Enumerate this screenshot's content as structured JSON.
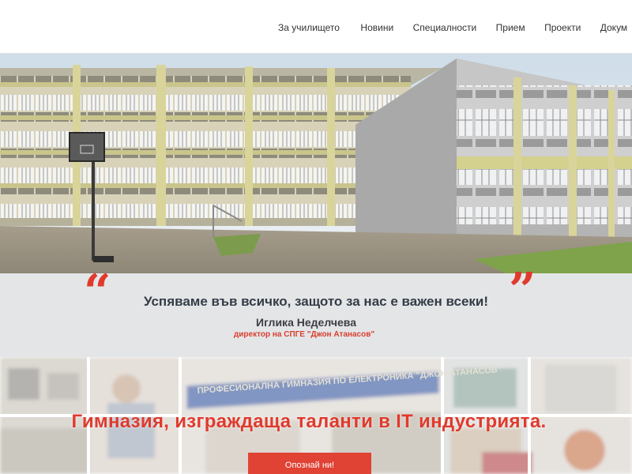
{
  "nav": {
    "items": [
      {
        "label": "За училището"
      },
      {
        "label": "Новини"
      },
      {
        "label": "Специалности"
      },
      {
        "label": "Прием"
      },
      {
        "label": "Проекти"
      },
      {
        "label": "Докум"
      }
    ]
  },
  "quote": {
    "text": "Успяваме във всичко, защото за нас е важен всеки!",
    "open_mark": "“",
    "close_mark": "”",
    "author": "Иглика Неделчева",
    "role": "директор на СПГЕ \"Джон Атанасов\""
  },
  "collage": {
    "tagline": "Гимназия, изграждаща таланти в IT индустрията.",
    "sign_text": "ПРОФЕСИОНАЛНА ГИМНАЗИЯ ПО ЕЛЕКТРОНИКА \"ДЖОН АТАНАСОВ\"",
    "cta_label": "Опознай ни!"
  },
  "colors": {
    "accent": "#e03a2d",
    "band_bg": "#e4e5e7",
    "text_dark": "#333d47"
  }
}
